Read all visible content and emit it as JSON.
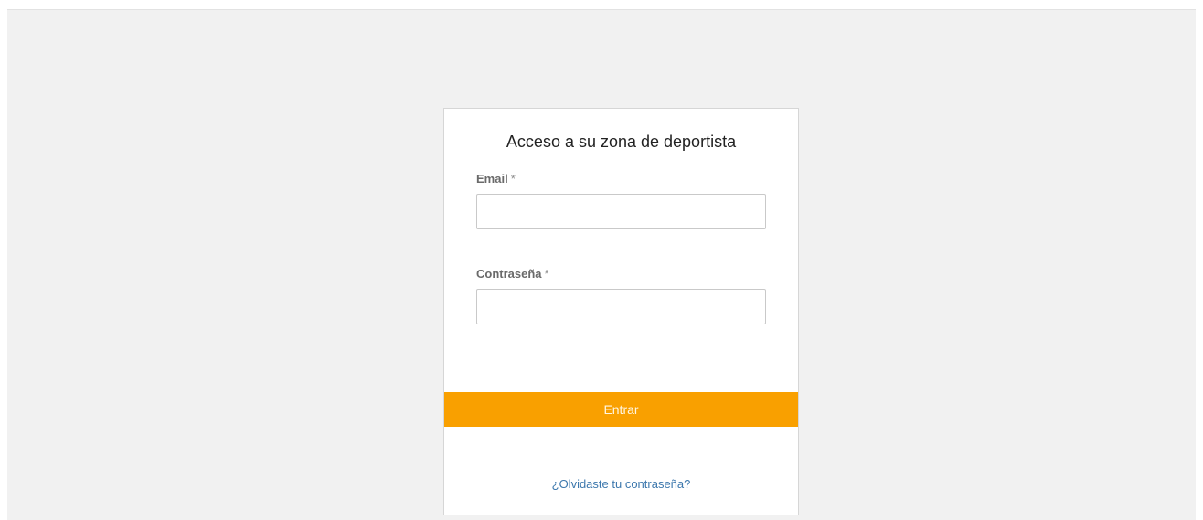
{
  "login": {
    "title": "Acceso a su zona de deportista",
    "email": {
      "label": "Email",
      "required_mark": "*",
      "value": "",
      "placeholder": ""
    },
    "password": {
      "label": "Contraseña",
      "required_mark": "*",
      "value": "",
      "placeholder": ""
    },
    "submit_label": "Entrar",
    "forgot_link": "¿Olvidaste tu contraseña?"
  },
  "colors": {
    "page_background": "#f1f1f1",
    "card_background": "#ffffff",
    "accent_button": "#f9a000",
    "link": "#3d78ad"
  }
}
